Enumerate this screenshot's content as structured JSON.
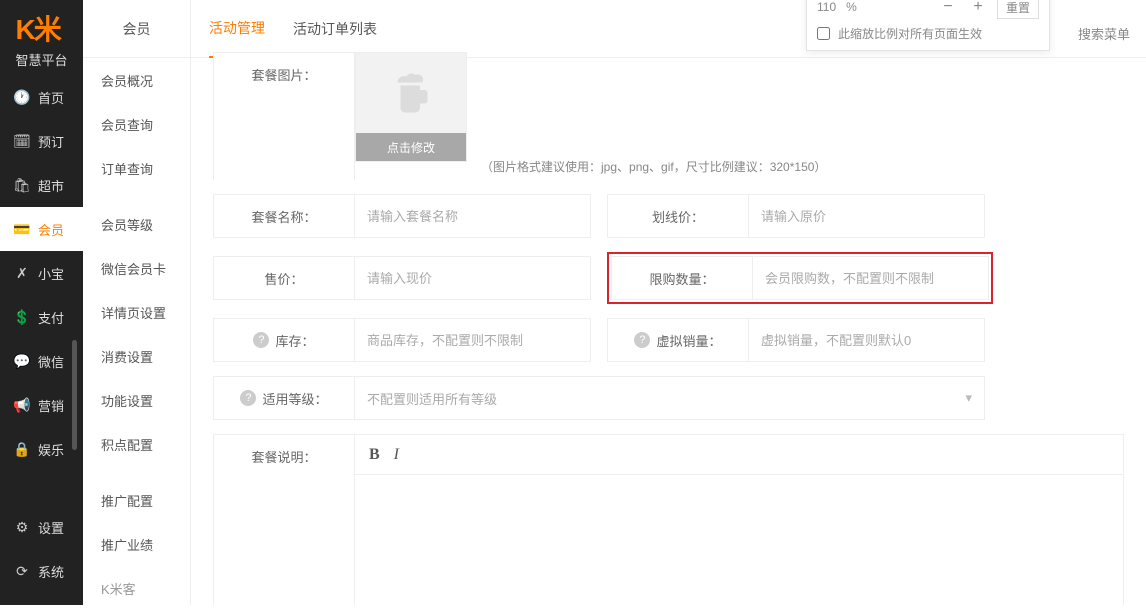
{
  "brand": {
    "logo": "K米",
    "sub": "智慧平台"
  },
  "leftnav": [
    {
      "icon": "🕐",
      "label": "首页"
    },
    {
      "icon": "🗓",
      "label": "预订"
    },
    {
      "icon": "🛍",
      "label": "超市"
    },
    {
      "icon": "💳",
      "label": "会员",
      "active": true
    },
    {
      "icon": "✗",
      "label": "小宝"
    },
    {
      "icon": "💲",
      "label": "支付"
    },
    {
      "icon": "💬",
      "label": "微信"
    },
    {
      "icon": "📢",
      "label": "营销"
    },
    {
      "icon": "🔒",
      "label": "娱乐"
    },
    {
      "icon": "⚙",
      "label": "设置"
    },
    {
      "icon": "⟳",
      "label": "系统"
    }
  ],
  "submenu": {
    "title": "会员",
    "items": [
      "会员概况",
      "会员查询",
      "订单查询",
      "会员等级",
      "微信会员卡",
      "详情页设置",
      "消费设置",
      "功能设置",
      "积点配置",
      "推广配置",
      "推广业绩",
      "K米客"
    ]
  },
  "tabs": [
    "活动管理",
    "活动订单列表"
  ],
  "form": {
    "pkg_image_label": "套餐图片：",
    "img_btn": "点击修改",
    "img_hint": "（图片格式建议使用：jpg、png、gif，尺寸比例建议：320*150）",
    "pkg_name_label": "套餐名称：",
    "pkg_name_ph": "请输入套餐名称",
    "strike_label": "划线价：",
    "strike_ph": "请输入原价",
    "price_label": "售价：",
    "price_ph": "请输入现价",
    "limit_label": "限购数量：",
    "limit_ph": "会员限购数，不配置则不限制",
    "stock_label": "库存：",
    "stock_ph": "商品库存，不配置则不限制",
    "virtual_label": "虚拟销量：",
    "virtual_ph": "虚拟销量，不配置则默认0",
    "level_label": "适用等级：",
    "level_ph": "不配置则适用所有等级",
    "desc_label": "套餐说明："
  },
  "zoom": {
    "value": "110",
    "unit": "%",
    "reset": "重置",
    "apply_all": "此缩放比例对所有页面生效"
  },
  "search_menu": "搜索菜单"
}
